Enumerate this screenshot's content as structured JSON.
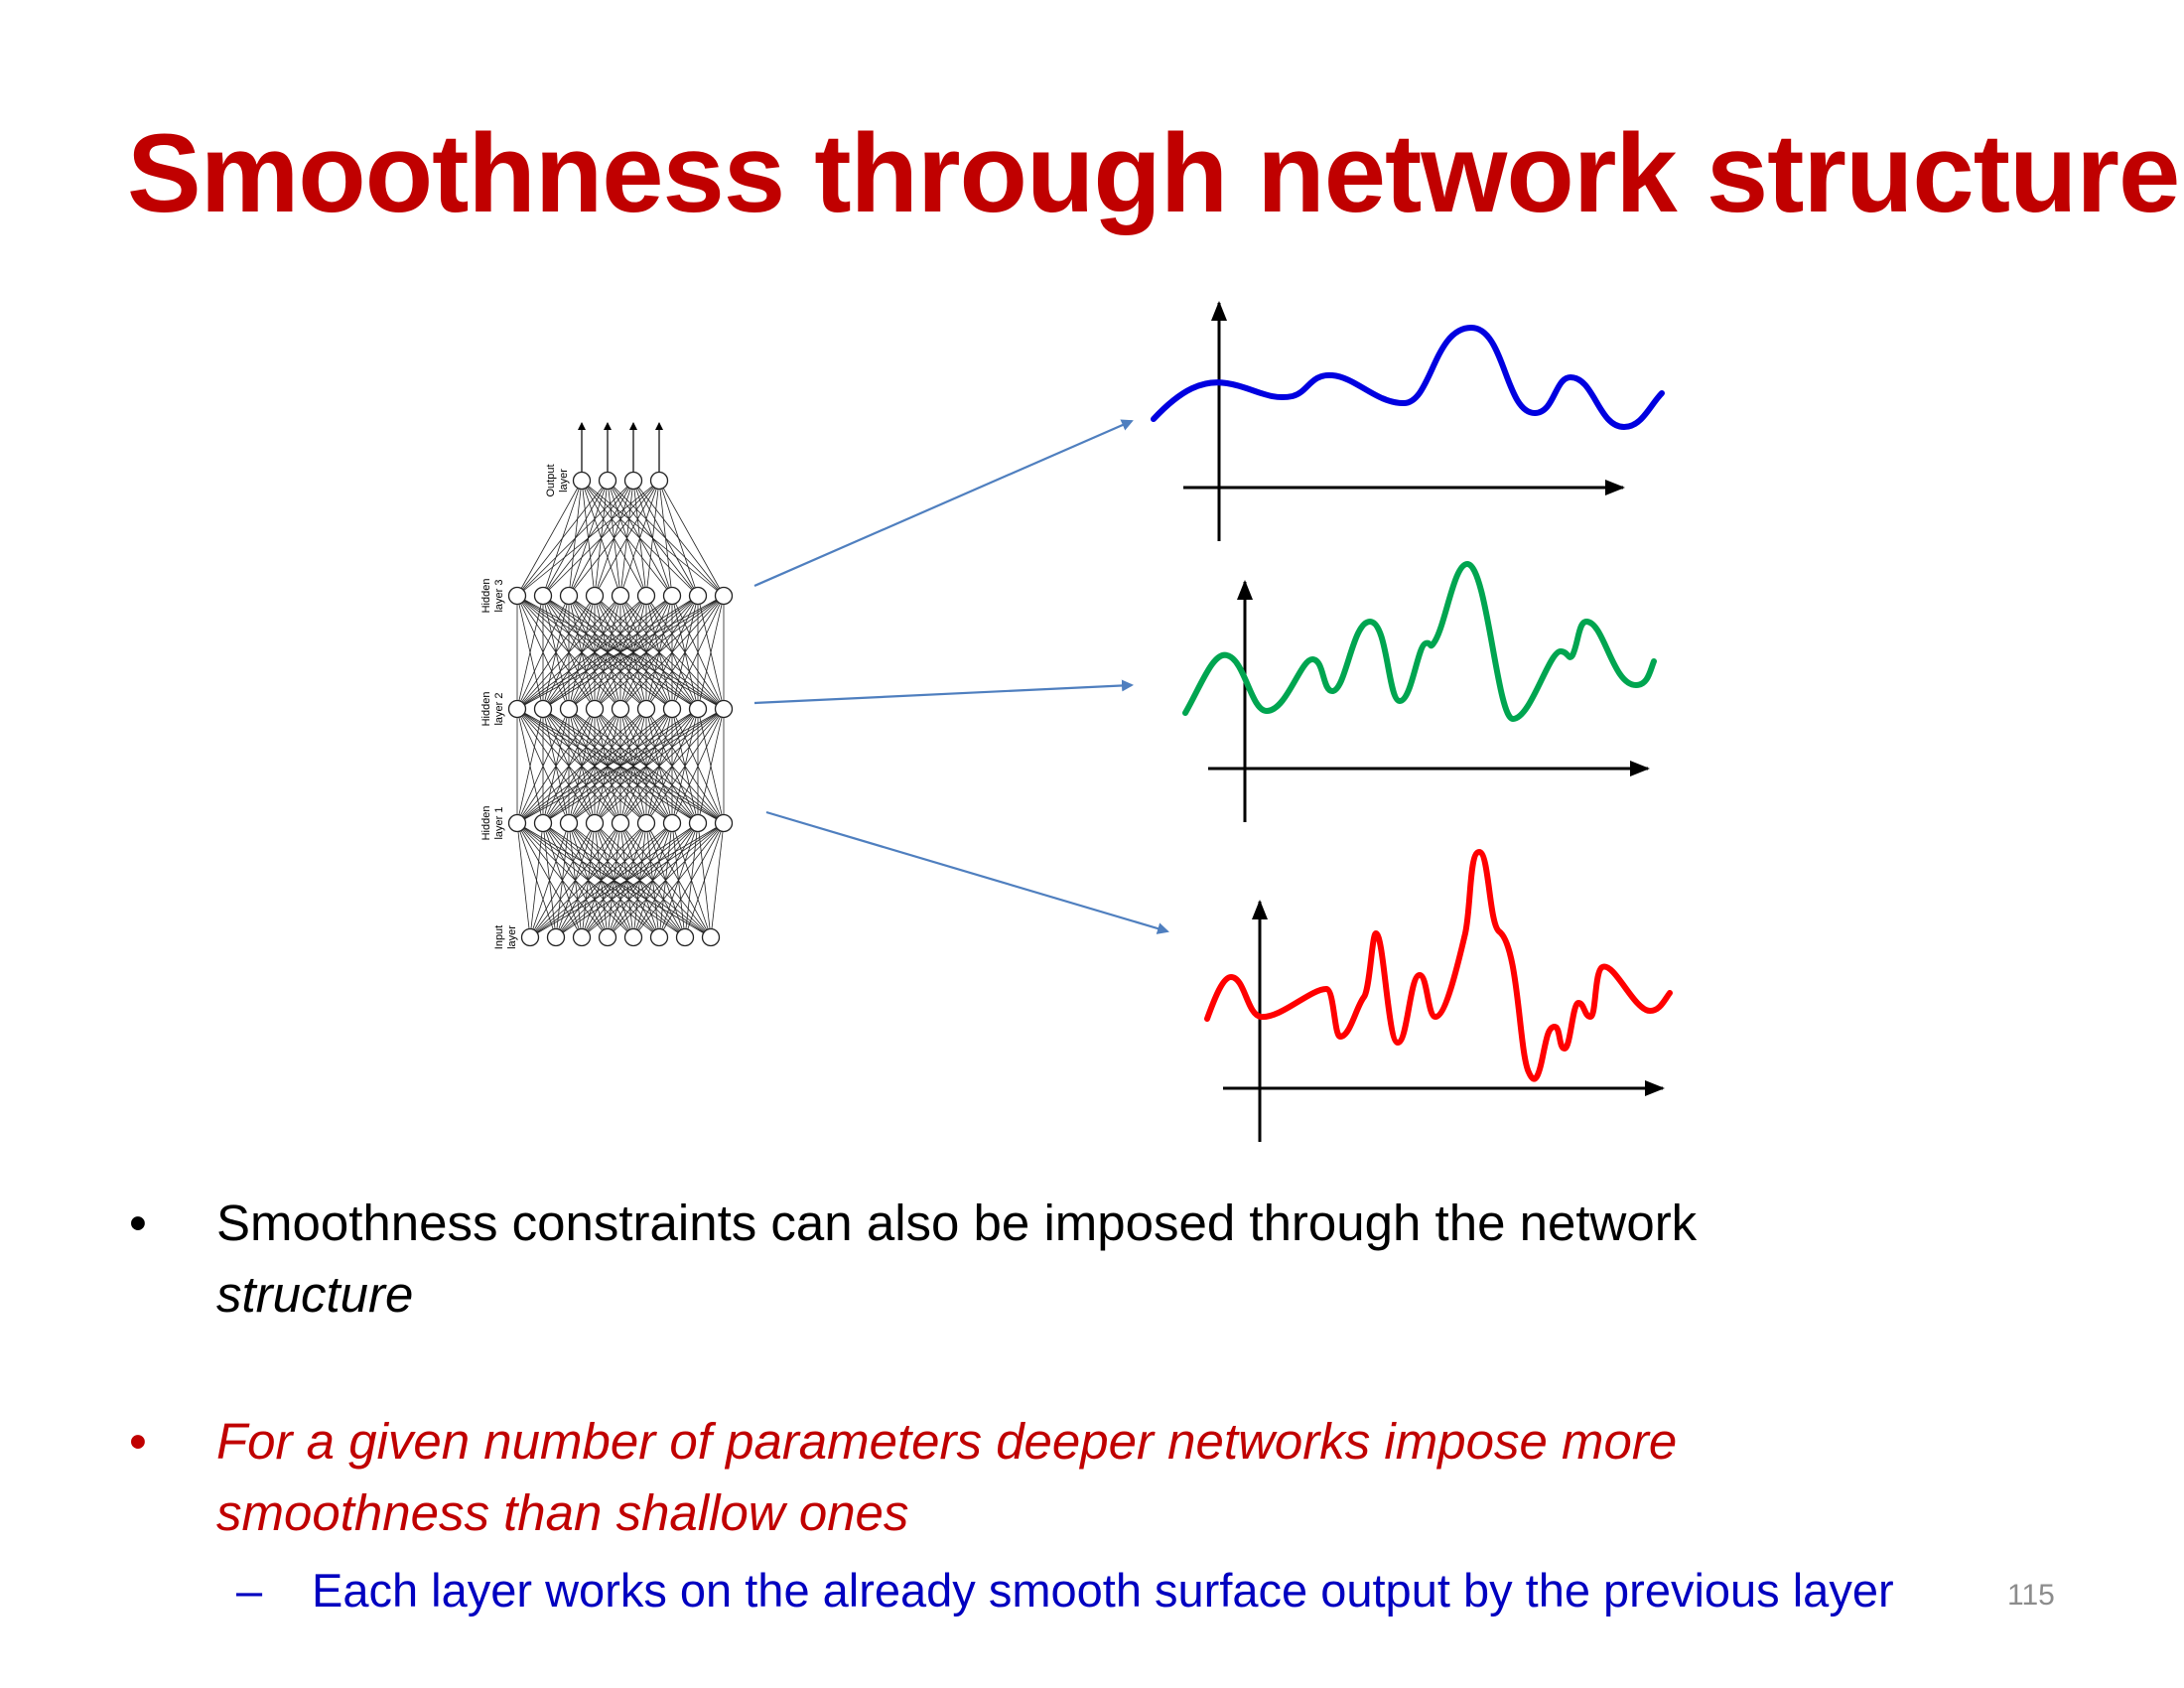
{
  "title": "Smoothness through network structure",
  "network": {
    "layers": [
      {
        "name": "Output layer",
        "label_lines": [
          "Output",
          "layer"
        ],
        "nodes": 4
      },
      {
        "name": "Hidden layer 3",
        "label_lines": [
          "Hidden",
          "layer 3"
        ],
        "nodes": 9
      },
      {
        "name": "Hidden layer 2",
        "label_lines": [
          "Hidden",
          "layer 2"
        ],
        "nodes": 9
      },
      {
        "name": "Hidden layer 1",
        "label_lines": [
          "Hidden",
          "layer 1"
        ],
        "nodes": 9
      },
      {
        "name": "Input layer",
        "label_lines": [
          "Input",
          "layer"
        ],
        "nodes": 8
      }
    ]
  },
  "curves": [
    {
      "color": "#0000e0",
      "description_key": "top"
    },
    {
      "color": "#00a550",
      "description_key": "middle"
    },
    {
      "color": "#ff0000",
      "description_key": "bottom"
    }
  ],
  "colors": {
    "title": "#c00000",
    "arrow": "#4f7fbf",
    "emphasis": "#c00000",
    "sub": "#0000c0"
  },
  "bullets": [
    {
      "dot": "•",
      "line1": "Smoothness constraints can also be imposed through the network",
      "line2": "structure"
    },
    {
      "dot": "•",
      "line1": "For a given number of parameters deeper networks impose more",
      "line2": "smoothness than shallow ones"
    }
  ],
  "sub_bullet": {
    "dash": "–",
    "text": "Each layer works on the already smooth surface output by the previous layer"
  },
  "page_number": "115"
}
